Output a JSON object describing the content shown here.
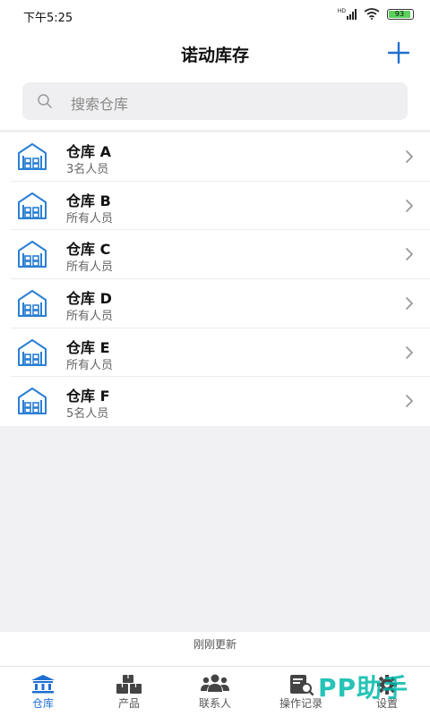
{
  "status": {
    "time": "下午5:25",
    "battery": "93",
    "network": "HD"
  },
  "header": {
    "title": "诺动库存"
  },
  "search": {
    "placeholder": "搜索仓库"
  },
  "warehouses": [
    {
      "name": "仓库 A",
      "members": "3名人员"
    },
    {
      "name": "仓库 B",
      "members": "所有人员"
    },
    {
      "name": "仓库 C",
      "members": "所有人员"
    },
    {
      "name": "仓库 D",
      "members": "所有人员"
    },
    {
      "name": "仓库 E",
      "members": "所有人员"
    },
    {
      "name": "仓库 F",
      "members": "5名人员"
    }
  ],
  "footer": {
    "updated": "刚刚更新"
  },
  "tabs": [
    {
      "label": "仓库",
      "icon": "warehouse-icon",
      "active": true
    },
    {
      "label": "产品",
      "icon": "boxes-icon",
      "active": false
    },
    {
      "label": "联系人",
      "icon": "contacts-icon",
      "active": false
    },
    {
      "label": "操作记录",
      "icon": "log-search-icon",
      "active": false
    },
    {
      "label": "设置",
      "icon": "gear-icon",
      "active": false
    }
  ],
  "watermark": "PP助手",
  "colors": {
    "accent": "#1f6fd1",
    "icon_blue": "#2a7fd4"
  }
}
